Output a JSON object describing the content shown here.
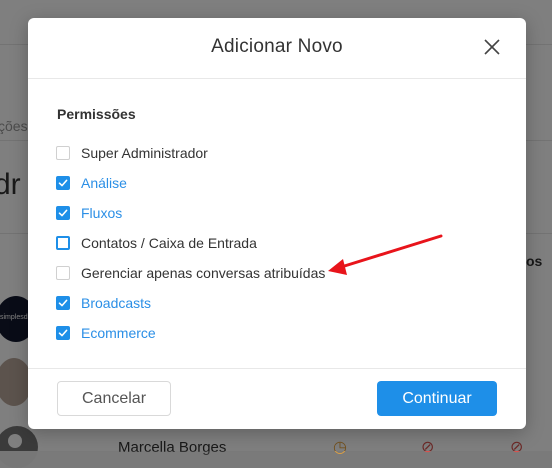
{
  "background": {
    "breadcrumb_fragment": "ções",
    "heading_fragment": "dr",
    "column_fragment": "os",
    "avatar_text": "simplesdi",
    "row_name": "Marcella Borges"
  },
  "modal": {
    "title": "Adicionar Novo",
    "close_icon": "close-icon",
    "section_title": "Permissões",
    "permissions": [
      {
        "label": "Super Administrador",
        "checked": false
      },
      {
        "label": "Análise",
        "checked": true
      },
      {
        "label": "Fluxos",
        "checked": true
      },
      {
        "label": "Contatos / Caixa de Entrada",
        "checked": false,
        "focused": true
      },
      {
        "label": "Gerenciar apenas conversas atribuídas",
        "checked": false
      },
      {
        "label": "Broadcasts",
        "checked": true
      },
      {
        "label": "Ecommerce",
        "checked": true
      }
    ],
    "cancel_label": "Cancelar",
    "continue_label": "Continuar"
  },
  "annotation": {
    "type": "arrow",
    "color": "#e8141b",
    "points_to": "Gerenciar apenas conversas atribuídas"
  },
  "colors": {
    "accent": "#1e8fe8",
    "link": "#2b8fe6",
    "arrow": "#e8141b"
  }
}
